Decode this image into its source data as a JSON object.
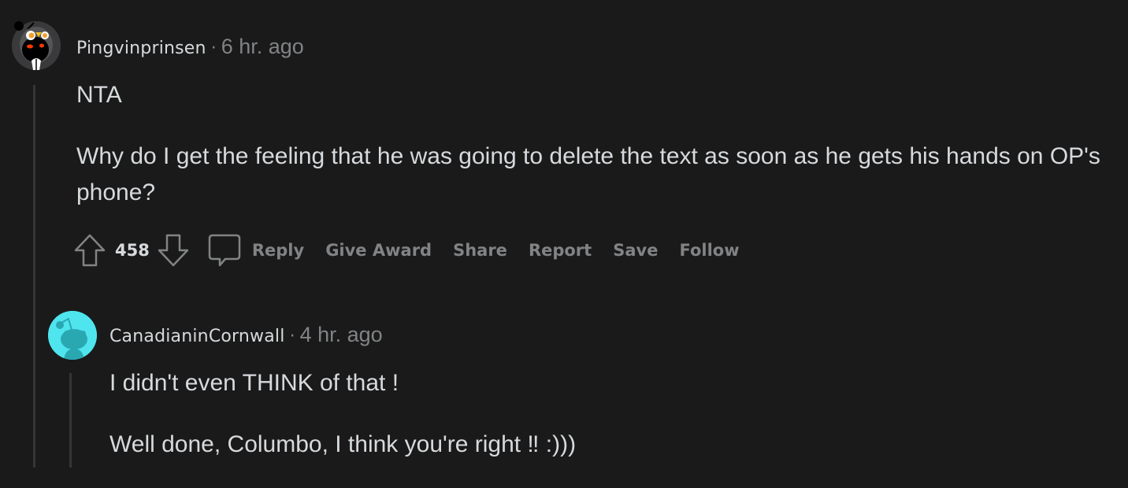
{
  "comments": [
    {
      "username": "Pingvinprinsen",
      "separator": "·",
      "time": "6 hr. ago",
      "avatar": "penguin-snoo-avatar",
      "paragraphs": [
        "NTA",
        "Why do I get the feeling that he was going to delete the text as soon as he gets his hands on OP's phone?"
      ],
      "score": "458",
      "actions": {
        "reply": "Reply",
        "give_award": "Give Award",
        "share": "Share",
        "report": "Report",
        "save": "Save",
        "follow": "Follow"
      }
    },
    {
      "username": "CanadianinCornwall",
      "separator": "·",
      "time": "4 hr. ago",
      "avatar": "default-snoo-avatar",
      "avatar_color": "#4fe5ee",
      "paragraphs": [
        "I didn't even THINK of that !",
        "Well done, Columbo, I think you're right ‼ :)))"
      ]
    }
  ]
}
